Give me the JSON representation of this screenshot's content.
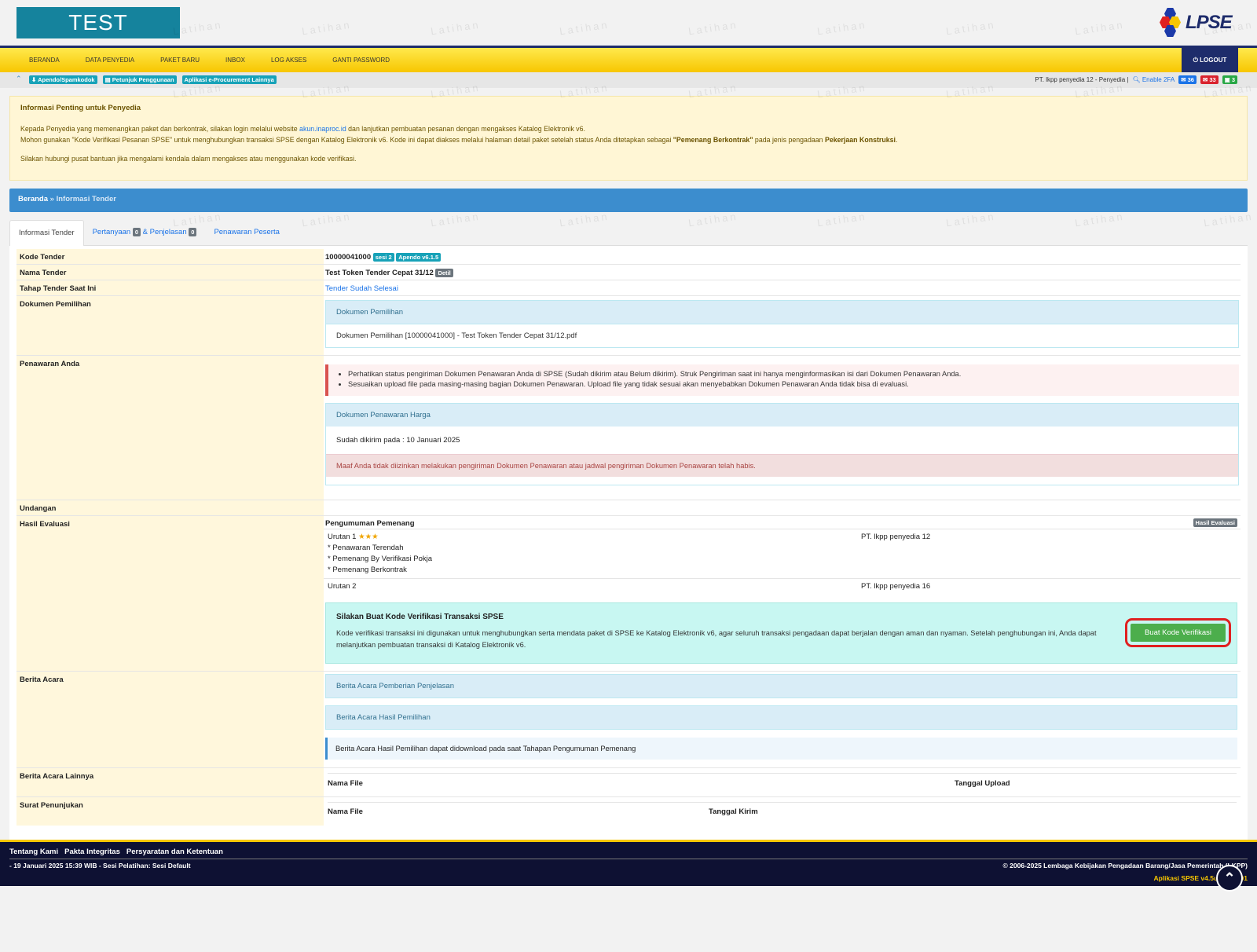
{
  "header": {
    "site_title": "TEST",
    "logo_text": "LPSE",
    "watermark": "Latihan"
  },
  "nav": {
    "items": [
      "BERANDA",
      "DATA PENYEDIA",
      "PAKET BARU",
      "INBOX",
      "LOG AKSES",
      "GANTI PASSWORD"
    ],
    "logout": "LOGOUT"
  },
  "subbar": {
    "links": [
      "Apendo/Spamkodok",
      "Petunjuk Penggunaan",
      "Aplikasi e-Procurement Lainnya"
    ],
    "user": "PT. lkpp penyedia 12 - Penyedia |",
    "enable2fa": "Enable 2FA",
    "counts": [
      "36",
      "33",
      "3"
    ]
  },
  "info": {
    "title": "Informasi Penting untuk Penyedia",
    "p1_a": "Kepada Penyedia yang memenangkan paket dan berkontrak, silakan login melalui website ",
    "p1_link": "akun.inaproc.id",
    "p1_b": " dan lanjutkan pembuatan pesanan dengan mengakses Katalog Elektronik v6.",
    "p2_a": "Mohon gunakan \"Kode Verifikasi Pesanan SPSE\" untuk menghubungkan transaksi SPSE dengan Katalog Elektronik v6. Kode ini dapat diakses melalui halaman detail paket setelah status Anda ditetapkan sebagai ",
    "p2_bold1": "\"Pemenang Berkontrak\"",
    "p2_b": " pada jenis pengadaan ",
    "p2_bold2": "Pekerjaan Konstruksi",
    "p2_c": ".",
    "p3": "Silakan hubungi pusat bantuan jika mengalami kendala dalam mengakses atau menggunakan kode verifikasi."
  },
  "breadcrumb": {
    "home": "Beranda",
    "sep": "»",
    "current": "Informasi Tender"
  },
  "tabs": {
    "t1": "Informasi Tender",
    "t2a": "Pertanyaan",
    "t2_badge1": "0",
    "t2b": "& Penjelasan",
    "t2_badge2": "0",
    "t3": "Penawaran Peserta"
  },
  "rows": {
    "kode_label": "Kode Tender",
    "kode_value": "10000041000",
    "kode_badge1": "sesi 2",
    "kode_badge2": "Apendo v6.1.5",
    "nama_label": "Nama Tender",
    "nama_value": "Test Token Tender Cepat 31/12",
    "nama_badge": "Detil",
    "tahap_label": "Tahap Tender Saat Ini",
    "tahap_value": "Tender Sudah Selesai",
    "dok_label": "Dokumen Pemilihan",
    "dok_head": "Dokumen Pemilihan",
    "dok_file": "Dokumen Pemilihan [10000041000] - Test Token Tender Cepat 31/12.pdf",
    "penawaran_label": "Penawaran Anda",
    "penawaran_note1": "Perhatikan status pengiriman Dokumen Penawaran Anda di SPSE (Sudah dikirim atau Belum dikirim). Struk Pengiriman saat ini hanya menginformasikan isi dari Dokumen Penawaran Anda.",
    "penawaran_note2": "Sesuaikan upload file pada masing-masing bagian Dokumen Penawaran. Upload file yang tidak sesuai akan menyebabkan Dokumen Penawaran Anda tidak bisa di evaluasi.",
    "harga_head": "Dokumen Penawaran Harga",
    "harga_sent": "Sudah dikirim pada : 10 Januari 2025",
    "harga_alert": "Maaf Anda tidak diizinkan melakukan pengiriman Dokumen Penawaran atau jadwal pengiriman Dokumen Penawaran telah habis.",
    "undangan_label": "Undangan",
    "hasil_label": "Hasil Evaluasi",
    "pengumuman": "Pengumuman Pemenang",
    "hasil_badge": "Hasil Evaluasi",
    "urutan1": "Urutan 1",
    "stars": "★★★",
    "u1_notes": [
      "* Penawaran Terendah",
      "* Pemenang By Verifikasi Pokja",
      "* Pemenang Berkontrak"
    ],
    "u1_company": "PT. lkpp penyedia 12",
    "urutan2": "Urutan 2",
    "u2_company": "PT. lkpp penyedia 16",
    "ver_title": "Silakan Buat Kode Verifikasi Transaksi SPSE",
    "ver_text": "Kode verifikasi transaksi ini digunakan untuk menghubungkan serta mendata paket di SPSE ke Katalog Elektronik v6, agar seluruh transaksi pengadaan dapat berjalan dengan aman dan nyaman. Setelah penghubungan ini, Anda dapat melanjutkan pembuatan transaksi di Katalog Elektronik v6.",
    "ver_button": "Buat Kode Verifikasi",
    "berita_label": "Berita Acara",
    "ba1": "Berita Acara Pemberian Penjelasan",
    "ba2": "Berita Acara Hasil Pemilihan",
    "ba_info": "Berita Acara Hasil Pemilihan dapat didownload pada saat Tahapan Pengumuman Pemenang",
    "lainnya_label": "Berita Acara Lainnya",
    "lainnya_col1": "Nama File",
    "lainnya_col2": "Tanggal Upload",
    "surat_label": "Surat Penunjukan",
    "surat_col1": "Nama File",
    "surat_col2": "Tanggal Kirim"
  },
  "footer": {
    "links": [
      "Tentang Kami",
      "Pakta Integritas",
      "Persyaratan dan Ketentuan"
    ],
    "session": "- 19 Januari 2025 15:39 WIB - Sesi Pelatihan: Sesi Default",
    "copyright": "© 2006-2025 Lembaga Kebijakan Pengadaan Barang/Jasa Pemerintah (LKPP)",
    "version": "Aplikasi SPSE v4.5u20250101"
  }
}
